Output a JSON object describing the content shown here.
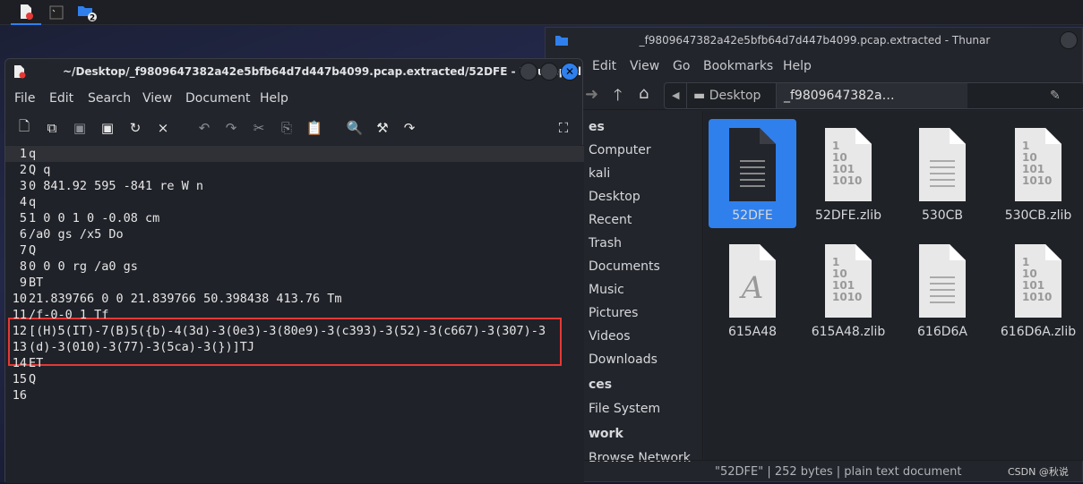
{
  "taskbar": {
    "items": [
      {
        "icon": "mousepad-icon",
        "active": true
      },
      {
        "icon": "terminal-icon"
      },
      {
        "icon": "folder-icon",
        "badge": "2"
      }
    ]
  },
  "thunar": {
    "title": "_f9809647382a42e5bfb64d7d447b4099.pcap.extracted - Thunar",
    "menu": [
      "Edit",
      "View",
      "Go",
      "Bookmarks",
      "Help"
    ],
    "path": {
      "segments": [
        "Desktop",
        "_f9809647382a…  .pcap.extracted"
      ]
    },
    "sidebar": [
      {
        "label": "es",
        "header": true
      },
      {
        "label": "Computer"
      },
      {
        "label": "kali"
      },
      {
        "label": "Desktop"
      },
      {
        "label": "Recent"
      },
      {
        "label": "Trash"
      },
      {
        "label": "Documents"
      },
      {
        "label": "Music"
      },
      {
        "label": "Pictures"
      },
      {
        "label": "Videos"
      },
      {
        "label": "Downloads"
      },
      {
        "label": "ces",
        "header": true
      },
      {
        "label": "File System"
      },
      {
        "label": "work",
        "header": true
      },
      {
        "label": "Browse Network"
      }
    ],
    "files": [
      {
        "name": "52DFE",
        "type": "text",
        "selected": true
      },
      {
        "name": "52DFE.zlib",
        "type": "binary"
      },
      {
        "name": "530CB",
        "type": "text"
      },
      {
        "name": "530CB.zlib",
        "type": "binary"
      },
      {
        "name": "615A48",
        "type": "font"
      },
      {
        "name": "615A48.zlib",
        "type": "binary"
      },
      {
        "name": "616D6A",
        "type": "text"
      },
      {
        "name": "616D6A.zlib",
        "type": "binary"
      }
    ],
    "binary_glyph": [
      "1",
      "10",
      "101",
      "1010"
    ],
    "font_glyph": "A",
    "status": "\"52DFE\" | 252 bytes | plain text document"
  },
  "mousepad": {
    "title": "~/Desktop/_f9809647382a42e5bfb64d7d447b4099.pcap.extracted/52DFE - Mousepad",
    "menu": [
      "File",
      "Edit",
      "Search",
      "View",
      "Document",
      "Help"
    ],
    "lines": [
      {
        "n": "1",
        "text": "q"
      },
      {
        "n": "2",
        "text": "Q q"
      },
      {
        "n": "3",
        "text": "0 841.92 595 -841 re W n"
      },
      {
        "n": "4",
        "text": "q"
      },
      {
        "n": "5",
        "text": "1 0 0 1 0 -0.08 cm"
      },
      {
        "n": "6",
        "text": "/a0 gs /x5 Do"
      },
      {
        "n": "7",
        "text": "Q"
      },
      {
        "n": "8",
        "text": "0 0 0 rg /a0 gs"
      },
      {
        "n": "9",
        "text": "BT"
      },
      {
        "n": "10",
        "text": "21.839766 0 0 21.839766 50.398438 413.76 Tm"
      },
      {
        "n": "11",
        "text": "/f-0-0 1 Tf"
      },
      {
        "n": "12",
        "text": "[(H)5(IT)-7(B)5({b)-4(3d)-3(0e3)-3(80e9)-3(c393)-3(52)-3(c667)-3(307)-3"
      },
      {
        "n": "13",
        "text": "(d)-3(010)-3(77)-3(5ca)-3(})]TJ"
      },
      {
        "n": "14",
        "text": "ET"
      },
      {
        "n": "15",
        "text": "Q"
      },
      {
        "n": "16",
        "text": ""
      }
    ]
  },
  "watermark": "CSDN @秋说",
  "colors": {
    "accent": "#2f80ed",
    "highlight": "#e53935"
  }
}
